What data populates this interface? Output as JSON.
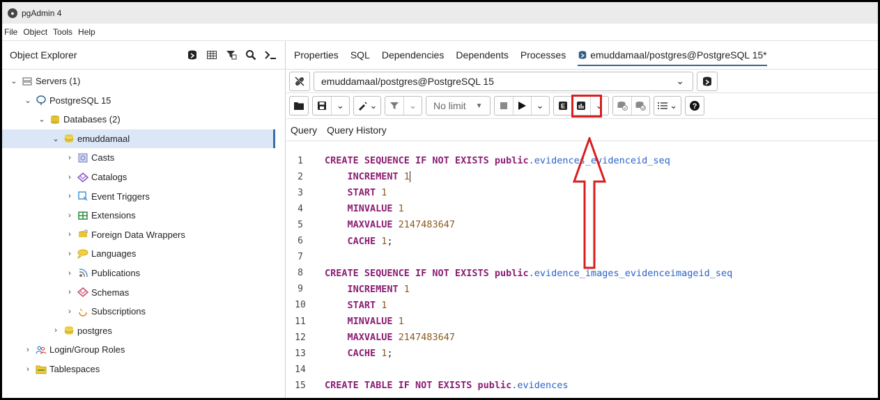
{
  "window": {
    "title": "pgAdmin 4"
  },
  "menu": [
    "File",
    "Object",
    "Tools",
    "Help"
  ],
  "object_explorer": {
    "title": "Object Explorer",
    "tree": [
      {
        "label": "Servers (1)",
        "icon": "servers-icon",
        "chev": "open",
        "indent": 0
      },
      {
        "label": "PostgreSQL 15",
        "icon": "postgres-elephant-icon",
        "chev": "open",
        "indent": 1
      },
      {
        "label": "Databases (2)",
        "icon": "databases-icon",
        "chev": "open",
        "indent": 2
      },
      {
        "label": "emuddamaal",
        "icon": "database-icon",
        "chev": "open",
        "indent": 3,
        "selected": true
      },
      {
        "label": "Casts",
        "icon": "casts-icon",
        "chev": "closed",
        "indent": 4
      },
      {
        "label": "Catalogs",
        "icon": "catalogs-icon",
        "chev": "closed",
        "indent": 4
      },
      {
        "label": "Event Triggers",
        "icon": "event-triggers-icon",
        "chev": "closed",
        "indent": 4
      },
      {
        "label": "Extensions",
        "icon": "extensions-icon",
        "chev": "closed",
        "indent": 4
      },
      {
        "label": "Foreign Data Wrappers",
        "icon": "foreign-data-wrappers-icon",
        "chev": "closed",
        "indent": 4
      },
      {
        "label": "Languages",
        "icon": "languages-icon",
        "chev": "closed",
        "indent": 4
      },
      {
        "label": "Publications",
        "icon": "publications-icon",
        "chev": "closed",
        "indent": 4
      },
      {
        "label": "Schemas",
        "icon": "schemas-icon",
        "chev": "closed",
        "indent": 4
      },
      {
        "label": "Subscriptions",
        "icon": "subscriptions-icon",
        "chev": "closed",
        "indent": 4
      },
      {
        "label": "postgres",
        "icon": "database-icon",
        "chev": "closed",
        "indent": 3
      },
      {
        "label": "Login/Group Roles",
        "icon": "login-roles-icon",
        "chev": "closed",
        "indent": 1
      },
      {
        "label": "Tablespaces",
        "icon": "tablespaces-icon",
        "chev": "closed",
        "indent": 1
      }
    ]
  },
  "tabs": [
    "Properties",
    "SQL",
    "Dependencies",
    "Dependents",
    "Processes"
  ],
  "active_tab": "emuddamaal/postgres@PostgreSQL 15*",
  "connection": "emuddamaal/postgres@PostgreSQL 15",
  "toolbar": {
    "limit": "No limit"
  },
  "query_tabs": [
    "Query",
    "Query History"
  ],
  "code_lines": [
    {
      "n": "1",
      "tokens": [
        [
          "kw",
          "CREATE SEQUENCE IF NOT EXISTS "
        ],
        [
          "kw",
          "public"
        ],
        [
          "id",
          ".evidences_evidenceid_seq"
        ]
      ]
    },
    {
      "n": "2",
      "tokens": [
        [
          "",
          "    "
        ],
        [
          "kw",
          "INCREMENT "
        ],
        [
          "num",
          "1"
        ],
        [
          "cursor",
          ""
        ]
      ]
    },
    {
      "n": "3",
      "tokens": [
        [
          "",
          "    "
        ],
        [
          "kw",
          "START "
        ],
        [
          "num",
          "1"
        ]
      ]
    },
    {
      "n": "4",
      "tokens": [
        [
          "",
          "    "
        ],
        [
          "kw",
          "MINVALUE "
        ],
        [
          "num",
          "1"
        ]
      ]
    },
    {
      "n": "5",
      "tokens": [
        [
          "",
          "    "
        ],
        [
          "kw",
          "MAXVALUE "
        ],
        [
          "num",
          "2147483647"
        ]
      ]
    },
    {
      "n": "6",
      "tokens": [
        [
          "",
          "    "
        ],
        [
          "kw",
          "CACHE "
        ],
        [
          "num",
          "1"
        ],
        [
          "",
          ";"
        ]
      ]
    },
    {
      "n": "7",
      "tokens": []
    },
    {
      "n": "8",
      "tokens": [
        [
          "kw",
          "CREATE SEQUENCE IF NOT EXISTS "
        ],
        [
          "kw",
          "public"
        ],
        [
          "id",
          ".evidence_images_evidenceimageid_seq"
        ]
      ]
    },
    {
      "n": "9",
      "tokens": [
        [
          "",
          "    "
        ],
        [
          "kw",
          "INCREMENT "
        ],
        [
          "num",
          "1"
        ]
      ]
    },
    {
      "n": "10",
      "tokens": [
        [
          "",
          "    "
        ],
        [
          "kw",
          "START "
        ],
        [
          "num",
          "1"
        ]
      ]
    },
    {
      "n": "11",
      "tokens": [
        [
          "",
          "    "
        ],
        [
          "kw",
          "MINVALUE "
        ],
        [
          "num",
          "1"
        ]
      ]
    },
    {
      "n": "12",
      "tokens": [
        [
          "",
          "    "
        ],
        [
          "kw",
          "MAXVALUE "
        ],
        [
          "num",
          "2147483647"
        ]
      ]
    },
    {
      "n": "13",
      "tokens": [
        [
          "",
          "    "
        ],
        [
          "kw",
          "CACHE "
        ],
        [
          "num",
          "1"
        ],
        [
          "",
          ";"
        ]
      ]
    },
    {
      "n": "14",
      "tokens": []
    },
    {
      "n": "15",
      "tokens": [
        [
          "kw",
          "CREATE TABLE IF NOT EXISTS "
        ],
        [
          "kw",
          "public"
        ],
        [
          "id",
          ".evidences"
        ]
      ]
    }
  ],
  "colors": {
    "highlight": "#d81e1e",
    "keyword": "#8b1d74",
    "identifier": "#2a62c9",
    "number": "#8a5a1d",
    "selection": "#dbe7f6"
  }
}
